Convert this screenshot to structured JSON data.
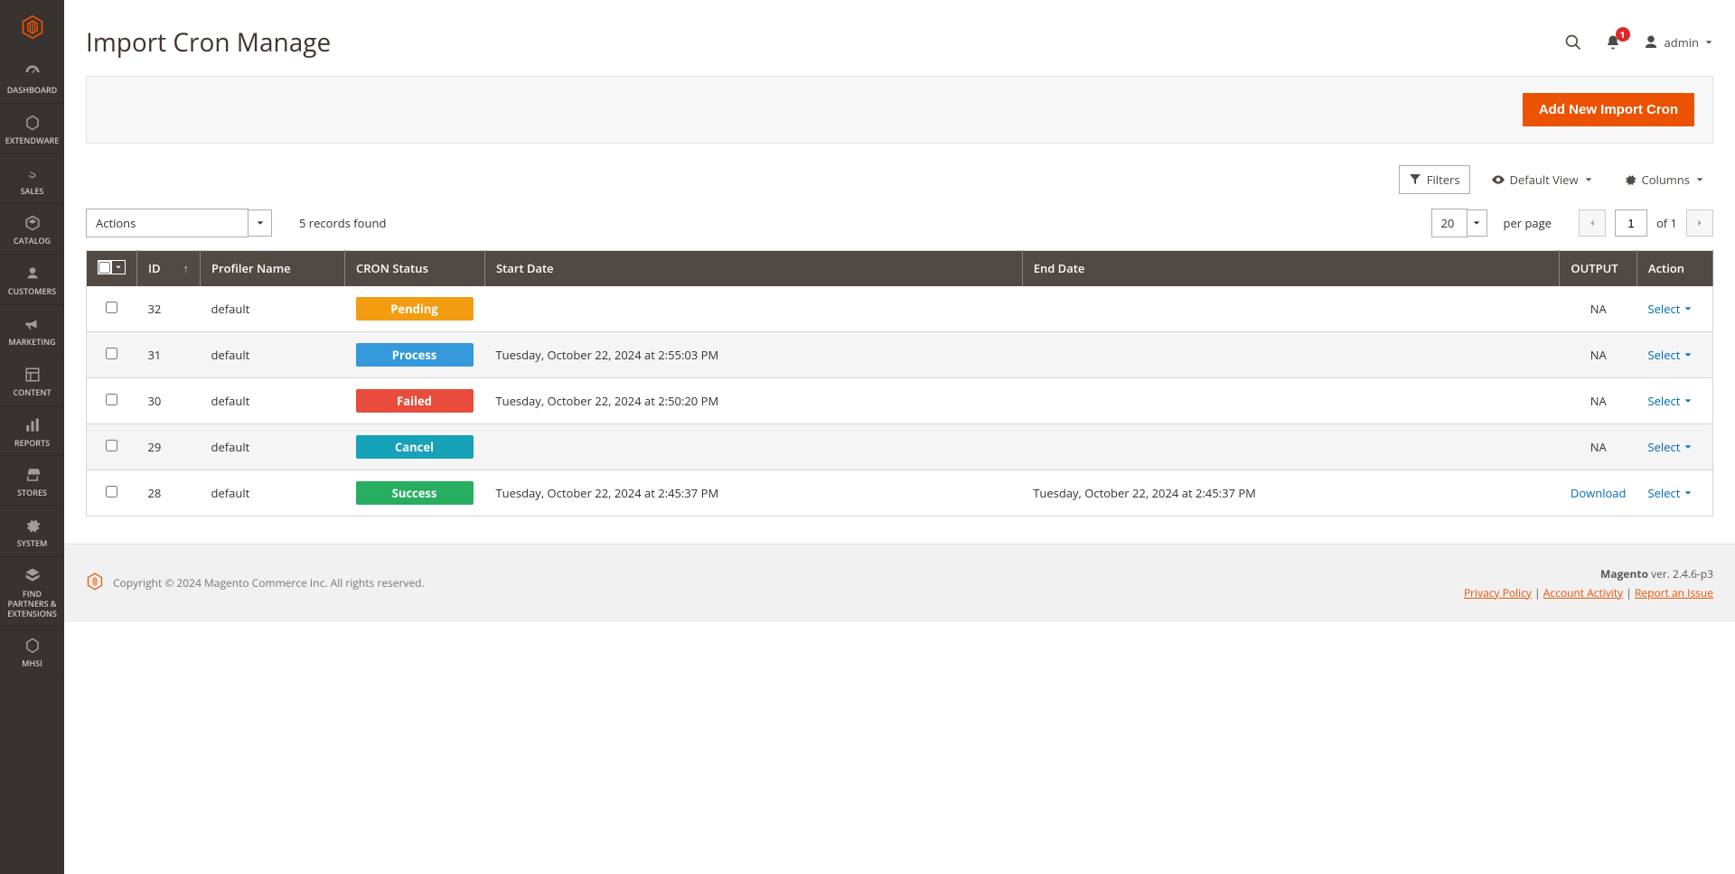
{
  "sidebar": {
    "items": [
      {
        "label": "Dashboard",
        "icon": "dashboard"
      },
      {
        "label": "Extendware",
        "icon": "hexagon"
      },
      {
        "label": "Sales",
        "icon": "dollar"
      },
      {
        "label": "Catalog",
        "icon": "cube"
      },
      {
        "label": "Customers",
        "icon": "person"
      },
      {
        "label": "Marketing",
        "icon": "megaphone"
      },
      {
        "label": "Content",
        "icon": "doc"
      },
      {
        "label": "Reports",
        "icon": "bars"
      },
      {
        "label": "Stores",
        "icon": "storefront"
      },
      {
        "label": "System",
        "icon": "gear"
      },
      {
        "label": "Find Partners & Extensions",
        "icon": "partners"
      },
      {
        "label": "MHSI",
        "icon": "hexagon"
      }
    ]
  },
  "header": {
    "title": "Import Cron Manage",
    "notification_count": "1",
    "user_label": "admin"
  },
  "action_bar": {
    "primary_button": "Add New Import Cron"
  },
  "grid_controls": {
    "filters": "Filters",
    "default_view": "Default View",
    "columns": "Columns"
  },
  "toolbar": {
    "actions_label": "Actions",
    "records_found": "5 records found",
    "per_page_value": "20",
    "per_page_label": "per page",
    "page_value": "1",
    "page_of": "of 1"
  },
  "table": {
    "headers": {
      "id": "ID",
      "profiler": "Profiler Name",
      "status": "CRON Status",
      "start": "Start Date",
      "end": "End Date",
      "output": "OUTPUT",
      "action": "Action"
    },
    "action_select_label": "Select",
    "rows": [
      {
        "id": "32",
        "profiler": "default",
        "status": "Pending",
        "status_class": "status-pending",
        "start": "",
        "end": "",
        "output": "NA",
        "output_link": false
      },
      {
        "id": "31",
        "profiler": "default",
        "status": "Process",
        "status_class": "status-process",
        "start": "Tuesday, October 22, 2024 at 2:55:03 PM",
        "end": "",
        "output": "NA",
        "output_link": false
      },
      {
        "id": "30",
        "profiler": "default",
        "status": "Failed",
        "status_class": "status-failed",
        "start": "Tuesday, October 22, 2024 at 2:50:20 PM",
        "end": "",
        "output": "NA",
        "output_link": false
      },
      {
        "id": "29",
        "profiler": "default",
        "status": "Cancel",
        "status_class": "status-cancel",
        "start": "",
        "end": "",
        "output": "NA",
        "output_link": false
      },
      {
        "id": "28",
        "profiler": "default",
        "status": "Success",
        "status_class": "status-success",
        "start": "Tuesday, October 22, 2024 at 2:45:37 PM",
        "end": "Tuesday, October 22, 2024 at 2:45:37 PM",
        "output": "Download",
        "output_link": true
      }
    ]
  },
  "footer": {
    "copyright": "Copyright © 2024 Magento Commerce Inc. All rights reserved.",
    "brand": "Magento",
    "version": " ver. 2.4.6-p3",
    "links": {
      "privacy": "Privacy Policy",
      "activity": "Account Activity",
      "report": "Report an Issue"
    }
  }
}
